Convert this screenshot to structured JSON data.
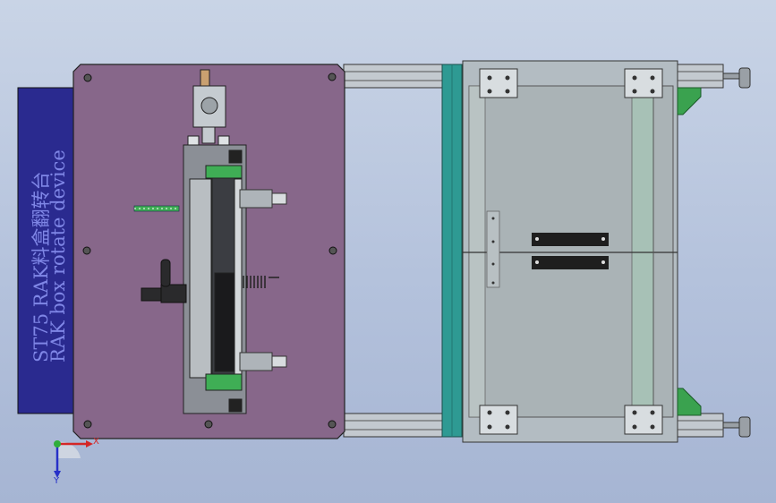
{
  "viewport": {
    "title_line1": "ST75   RAK料盒翻转台",
    "title_line2": "RAK box rotate device"
  },
  "triad": {
    "x_axis": "X",
    "y_axis": "Y"
  },
  "colors": {
    "background_top": "#c9d4e6",
    "background_bottom": "#a6b5d3",
    "plate": "#87678a",
    "label_plate": "#2a2a8f",
    "teal_bar": "#2e9a93",
    "frame": "#b9c1c6",
    "green_part": "#3fae55"
  }
}
